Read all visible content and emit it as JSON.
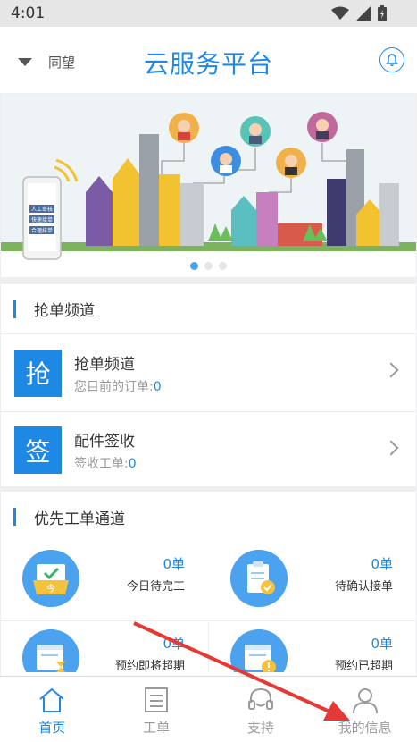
{
  "status_bar": {
    "time": "4:01",
    "icons": [
      "wifi-icon",
      "signal-icon",
      "battery-icon"
    ]
  },
  "header": {
    "location": "同望",
    "title": "云服务平台",
    "bell_icon": "bell-icon"
  },
  "banner": {
    "phone_buttons": [
      "人工审核",
      "快速接单",
      "合理排单"
    ],
    "slides": 3,
    "active_slide": 1
  },
  "grab_section": {
    "title": "抢单频道",
    "items": [
      {
        "badge": "抢",
        "title": "抢单频道",
        "subtitle": "您目前的订单:",
        "count": "0"
      },
      {
        "badge": "签",
        "title": "配件签收",
        "subtitle": "签收工单:",
        "count": "0"
      }
    ]
  },
  "priority_section": {
    "title": "优先工单通道",
    "cards": [
      {
        "count": "0单",
        "label": "今日待完工",
        "icon": "calendar-today-icon",
        "icon_text": "今"
      },
      {
        "count": "0单",
        "label": "待确认接单",
        "icon": "clipboard-check-icon"
      },
      {
        "count": "0单",
        "label": "预约即将超期",
        "icon": "calendar-hourglass-icon"
      },
      {
        "count": "0单",
        "label": "预约已超期",
        "icon": "calendar-warning-icon"
      }
    ]
  },
  "tabbar": {
    "tabs": [
      {
        "label": "首页",
        "icon": "home-icon",
        "active": true
      },
      {
        "label": "工单",
        "icon": "document-list-icon",
        "active": false
      },
      {
        "label": "支持",
        "icon": "headset-icon",
        "active": false
      },
      {
        "label": "我的信息",
        "icon": "user-icon",
        "active": false
      }
    ]
  },
  "colors": {
    "accent": "#1e88e5",
    "annotation_arrow": "#e53935"
  }
}
